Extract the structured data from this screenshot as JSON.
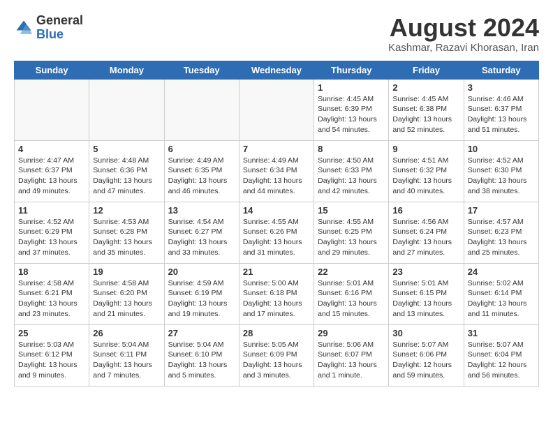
{
  "header": {
    "logo_general": "General",
    "logo_blue": "Blue",
    "month_year": "August 2024",
    "location": "Kashmar, Razavi Khorasan, Iran"
  },
  "weekdays": [
    "Sunday",
    "Monday",
    "Tuesday",
    "Wednesday",
    "Thursday",
    "Friday",
    "Saturday"
  ],
  "weeks": [
    [
      {
        "day": "",
        "empty": true
      },
      {
        "day": "",
        "empty": true
      },
      {
        "day": "",
        "empty": true
      },
      {
        "day": "",
        "empty": true
      },
      {
        "day": "1",
        "sunrise": "4:45 AM",
        "sunset": "6:39 PM",
        "daylight": "13 hours and 54 minutes."
      },
      {
        "day": "2",
        "sunrise": "4:45 AM",
        "sunset": "6:38 PM",
        "daylight": "13 hours and 52 minutes."
      },
      {
        "day": "3",
        "sunrise": "4:46 AM",
        "sunset": "6:37 PM",
        "daylight": "13 hours and 51 minutes."
      }
    ],
    [
      {
        "day": "4",
        "sunrise": "4:47 AM",
        "sunset": "6:37 PM",
        "daylight": "13 hours and 49 minutes."
      },
      {
        "day": "5",
        "sunrise": "4:48 AM",
        "sunset": "6:36 PM",
        "daylight": "13 hours and 47 minutes."
      },
      {
        "day": "6",
        "sunrise": "4:49 AM",
        "sunset": "6:35 PM",
        "daylight": "13 hours and 46 minutes."
      },
      {
        "day": "7",
        "sunrise": "4:49 AM",
        "sunset": "6:34 PM",
        "daylight": "13 hours and 44 minutes."
      },
      {
        "day": "8",
        "sunrise": "4:50 AM",
        "sunset": "6:33 PM",
        "daylight": "13 hours and 42 minutes."
      },
      {
        "day": "9",
        "sunrise": "4:51 AM",
        "sunset": "6:32 PM",
        "daylight": "13 hours and 40 minutes."
      },
      {
        "day": "10",
        "sunrise": "4:52 AM",
        "sunset": "6:30 PM",
        "daylight": "13 hours and 38 minutes."
      }
    ],
    [
      {
        "day": "11",
        "sunrise": "4:52 AM",
        "sunset": "6:29 PM",
        "daylight": "13 hours and 37 minutes."
      },
      {
        "day": "12",
        "sunrise": "4:53 AM",
        "sunset": "6:28 PM",
        "daylight": "13 hours and 35 minutes."
      },
      {
        "day": "13",
        "sunrise": "4:54 AM",
        "sunset": "6:27 PM",
        "daylight": "13 hours and 33 minutes."
      },
      {
        "day": "14",
        "sunrise": "4:55 AM",
        "sunset": "6:26 PM",
        "daylight": "13 hours and 31 minutes."
      },
      {
        "day": "15",
        "sunrise": "4:55 AM",
        "sunset": "6:25 PM",
        "daylight": "13 hours and 29 minutes."
      },
      {
        "day": "16",
        "sunrise": "4:56 AM",
        "sunset": "6:24 PM",
        "daylight": "13 hours and 27 minutes."
      },
      {
        "day": "17",
        "sunrise": "4:57 AM",
        "sunset": "6:23 PM",
        "daylight": "13 hours and 25 minutes."
      }
    ],
    [
      {
        "day": "18",
        "sunrise": "4:58 AM",
        "sunset": "6:21 PM",
        "daylight": "13 hours and 23 minutes."
      },
      {
        "day": "19",
        "sunrise": "4:58 AM",
        "sunset": "6:20 PM",
        "daylight": "13 hours and 21 minutes."
      },
      {
        "day": "20",
        "sunrise": "4:59 AM",
        "sunset": "6:19 PM",
        "daylight": "13 hours and 19 minutes."
      },
      {
        "day": "21",
        "sunrise": "5:00 AM",
        "sunset": "6:18 PM",
        "daylight": "13 hours and 17 minutes."
      },
      {
        "day": "22",
        "sunrise": "5:01 AM",
        "sunset": "6:16 PM",
        "daylight": "13 hours and 15 minutes."
      },
      {
        "day": "23",
        "sunrise": "5:01 AM",
        "sunset": "6:15 PM",
        "daylight": "13 hours and 13 minutes."
      },
      {
        "day": "24",
        "sunrise": "5:02 AM",
        "sunset": "6:14 PM",
        "daylight": "13 hours and 11 minutes."
      }
    ],
    [
      {
        "day": "25",
        "sunrise": "5:03 AM",
        "sunset": "6:12 PM",
        "daylight": "13 hours and 9 minutes."
      },
      {
        "day": "26",
        "sunrise": "5:04 AM",
        "sunset": "6:11 PM",
        "daylight": "13 hours and 7 minutes."
      },
      {
        "day": "27",
        "sunrise": "5:04 AM",
        "sunset": "6:10 PM",
        "daylight": "13 hours and 5 minutes."
      },
      {
        "day": "28",
        "sunrise": "5:05 AM",
        "sunset": "6:09 PM",
        "daylight": "13 hours and 3 minutes."
      },
      {
        "day": "29",
        "sunrise": "5:06 AM",
        "sunset": "6:07 PM",
        "daylight": "13 hours and 1 minute."
      },
      {
        "day": "30",
        "sunrise": "5:07 AM",
        "sunset": "6:06 PM",
        "daylight": "12 hours and 59 minutes."
      },
      {
        "day": "31",
        "sunrise": "5:07 AM",
        "sunset": "6:04 PM",
        "daylight": "12 hours and 56 minutes."
      }
    ]
  ]
}
